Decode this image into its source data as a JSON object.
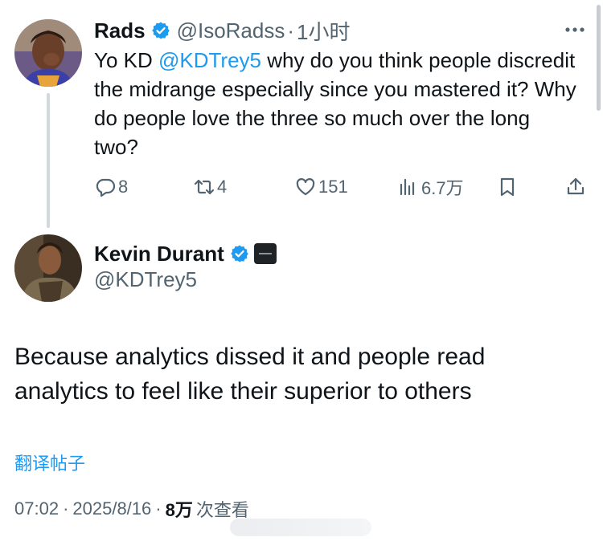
{
  "colors": {
    "accent": "#1d9bf0",
    "text": "#0f1419",
    "secondary": "#536471",
    "verified": "#1d9bf0"
  },
  "parent_tweet": {
    "name": "Rads",
    "handle": "@IsoRadss",
    "separator": "·",
    "time": "1小时",
    "text_before": "Yo KD ",
    "mention": "@KDTrey5",
    "text_after": " why do you think people discredit the midrange especially since you mastered it? Why do people love the three so much over the long two?",
    "reply_count": "8",
    "retweet_count": "4",
    "like_count": "151",
    "view_count": "6.7万"
  },
  "reply_tweet": {
    "name": "Kevin Durant",
    "handle": "@KDTrey5",
    "text": "Because analytics dissed it and people read analytics to feel like their superior to others",
    "translate_label": "翻译帖子",
    "timestamp": "07:02",
    "date": "2025/8/16",
    "separator": "·",
    "views_count": "8万",
    "views_label": "次查看"
  },
  "icons": [
    "more-icon",
    "verified-badge-icon",
    "reply-icon",
    "retweet-icon",
    "like-icon",
    "views-icon",
    "bookmark-icon",
    "share-icon",
    "affiliate-badge-icon"
  ]
}
